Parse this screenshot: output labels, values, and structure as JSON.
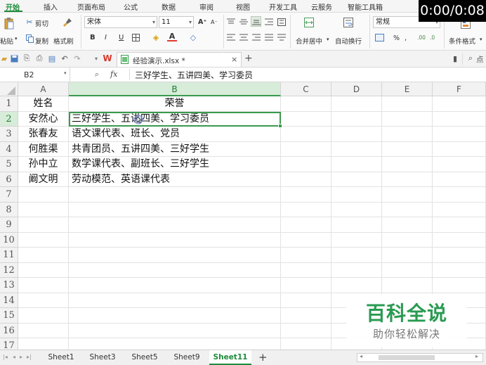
{
  "overlay": {
    "timer": "0:00/0:08"
  },
  "watermark": {
    "title": "百科全说",
    "subtitle": "助你轻松解决"
  },
  "menu_tabs": [
    "开始",
    "插入",
    "页面布局",
    "公式",
    "数据",
    "审阅",
    "视图",
    "开发工具",
    "云服务",
    "智能工具箱"
  ],
  "ribbon": {
    "paste": "粘贴",
    "cut": "剪切",
    "copy": "复制",
    "format_painter": "格式刷",
    "font_name": "宋体",
    "font_size": "11",
    "bold": "B",
    "italic": "I",
    "underline": "U",
    "grow_font": "A⁺",
    "shrink_font": "A⁻",
    "merge_center": "合并居中",
    "wrap_text": "自动换行",
    "number_format": "常规",
    "percent": "%",
    "thousands": ",",
    "dec_inc": ".00",
    "dec_dec": ".0",
    "conditional_format": "条件格式"
  },
  "quick_bar": {
    "doc_tab": "经验演示.xlsx *",
    "new_tab": "+",
    "search_placeholder": "点"
  },
  "formula_bar": {
    "name_box": "B2",
    "fx": "fx",
    "content": "三好学生、五讲四美、学习委员"
  },
  "columns": [
    "A",
    "B",
    "C",
    "D",
    "E",
    "F"
  ],
  "rows": [
    "1",
    "2",
    "3",
    "4",
    "5",
    "6",
    "7",
    "8",
    "9",
    "10",
    "11",
    "12",
    "13",
    "14",
    "15",
    "16",
    "17"
  ],
  "cells": [
    {
      "a": "姓名",
      "b": "荣誉"
    },
    {
      "a": "安然心",
      "b": "三好学生、五讲四美、学习委员"
    },
    {
      "a": "张春友",
      "b": "语文课代表、班长、党员"
    },
    {
      "a": "何胜渠",
      "b": "共青团员、五讲四美、三好学生"
    },
    {
      "a": "孙中立",
      "b": "数学课代表、副班长、三好学生"
    },
    {
      "a": "阚文明",
      "b": "劳动模范、英语课代表"
    }
  ],
  "sheets": [
    "Sheet1",
    "Sheet3",
    "Sheet5",
    "Sheet9",
    "Sheet11"
  ],
  "active_sheet": "Sheet11",
  "sheet_add": "+",
  "accent_color": "#1e8b3c"
}
